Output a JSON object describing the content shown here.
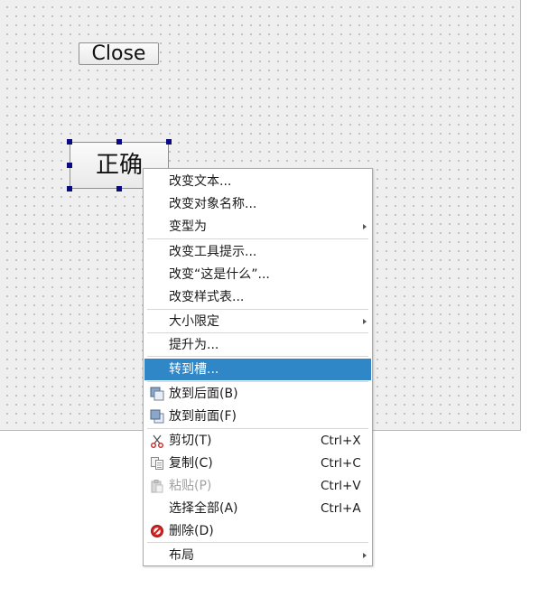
{
  "form": {
    "close_button_label": "Close",
    "ok_button_label": "正确"
  },
  "context_menu": {
    "items": [
      {
        "label": "改变文本..."
      },
      {
        "label": "改变对象名称..."
      },
      {
        "label": "变型为",
        "submenu": true
      },
      {
        "label": "改变工具提示..."
      },
      {
        "label": "改变“这是什么”..."
      },
      {
        "label": "改变样式表..."
      },
      {
        "label": "大小限定",
        "submenu": true
      },
      {
        "label": "提升为..."
      },
      {
        "label": "转到槽...",
        "highlighted": true
      },
      {
        "label": "放到后面(B)",
        "icon": "send-to-back-icon"
      },
      {
        "label": "放到前面(F)",
        "icon": "bring-to-front-icon"
      },
      {
        "label": "剪切(T)",
        "shortcut": "Ctrl+X",
        "icon": "scissors-icon"
      },
      {
        "label": "复制(C)",
        "shortcut": "Ctrl+C",
        "icon": "copy-icon"
      },
      {
        "label": "粘贴(P)",
        "shortcut": "Ctrl+V",
        "icon": "paste-icon",
        "disabled": true
      },
      {
        "label": "选择全部(A)",
        "shortcut": "Ctrl+A"
      },
      {
        "label": "删除(D)",
        "icon": "delete-icon"
      },
      {
        "label": "布局",
        "submenu": true
      }
    ]
  },
  "colors": {
    "highlight": "#2f87c7",
    "selection_handle": "#0b0b80",
    "delete_icon": "#d42020"
  }
}
